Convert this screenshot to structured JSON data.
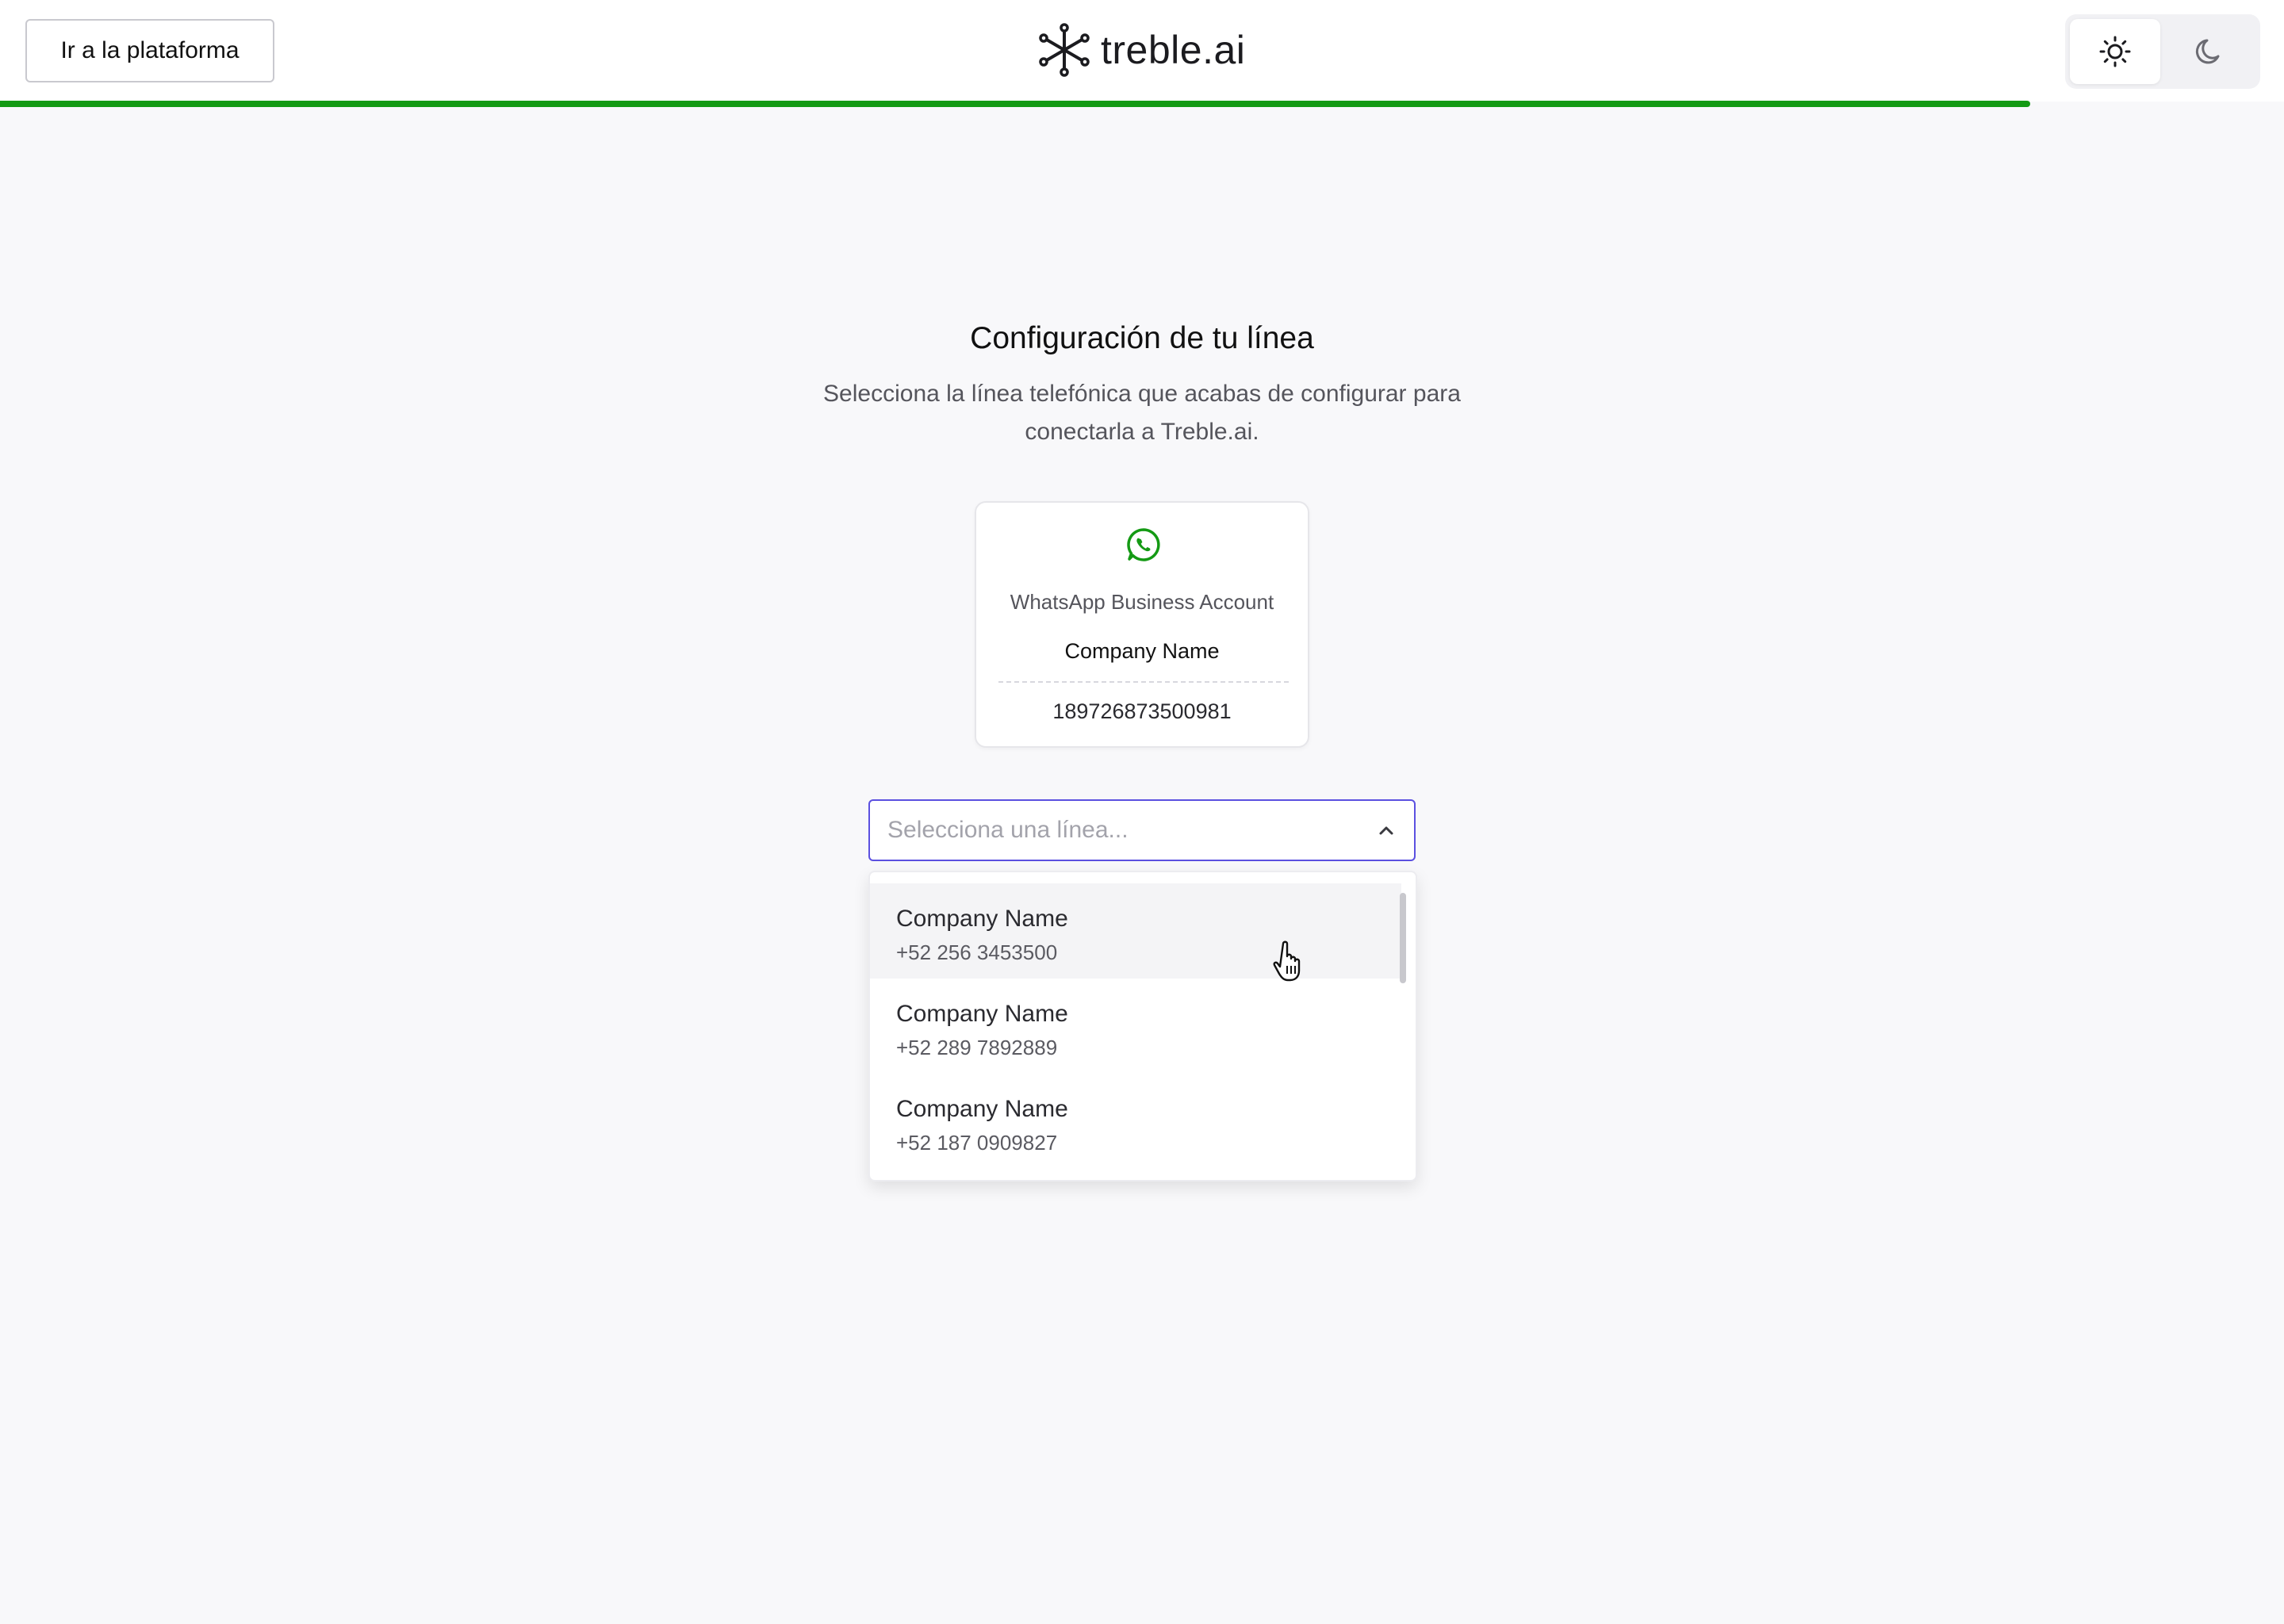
{
  "header": {
    "platform_button": "Ir a la plataforma",
    "logo_text": "treble.ai",
    "theme": {
      "active": "light",
      "options": [
        "light-icon",
        "dark-icon"
      ]
    },
    "progress": 0.889,
    "progress_color": "#149a14"
  },
  "main": {
    "title": "Configuración de tu línea",
    "subtitle": "Selecciona la línea telefónica que acabas de configurar para conectarla a Treble.ai."
  },
  "waba_card": {
    "icon": "whatsapp-icon",
    "label": "WhatsApp Business Account",
    "company": "Company Name",
    "id": "189726873500981"
  },
  "line_select": {
    "placeholder": "Selecciona una línea...",
    "expanded": true,
    "options": [
      {
        "name": "Company Name",
        "phone": "+52 256 3453500"
      },
      {
        "name": "Company Name",
        "phone": "+52 289 7892889"
      },
      {
        "name": "Company Name",
        "phone": "+52 187 0909827"
      }
    ]
  },
  "colors": {
    "accent": "#5b50e0",
    "whatsapp": "#149a14",
    "background": "#f8f8fa"
  }
}
